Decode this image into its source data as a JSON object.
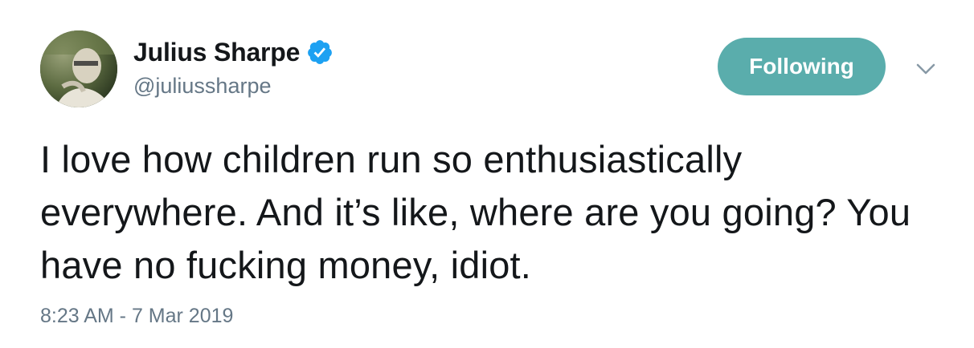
{
  "user": {
    "display_name": "Julius Sharpe",
    "handle": "@juliussharpe",
    "verified": true
  },
  "follow_button": {
    "label": "Following"
  },
  "tweet": {
    "text": "I love how children run so enthusiastically everywhere. And it’s like, where are you going? You have no fucking money, idiot.",
    "timestamp": "8:23 AM - 7 Mar 2019"
  },
  "icons": {
    "verified": "verified-badge-icon",
    "menu": "chevron-down-icon"
  },
  "colors": {
    "follow_button_bg": "#5aadac",
    "verified_blue": "#1da1f2",
    "secondary_text": "#657786",
    "primary_text": "#14171a"
  }
}
